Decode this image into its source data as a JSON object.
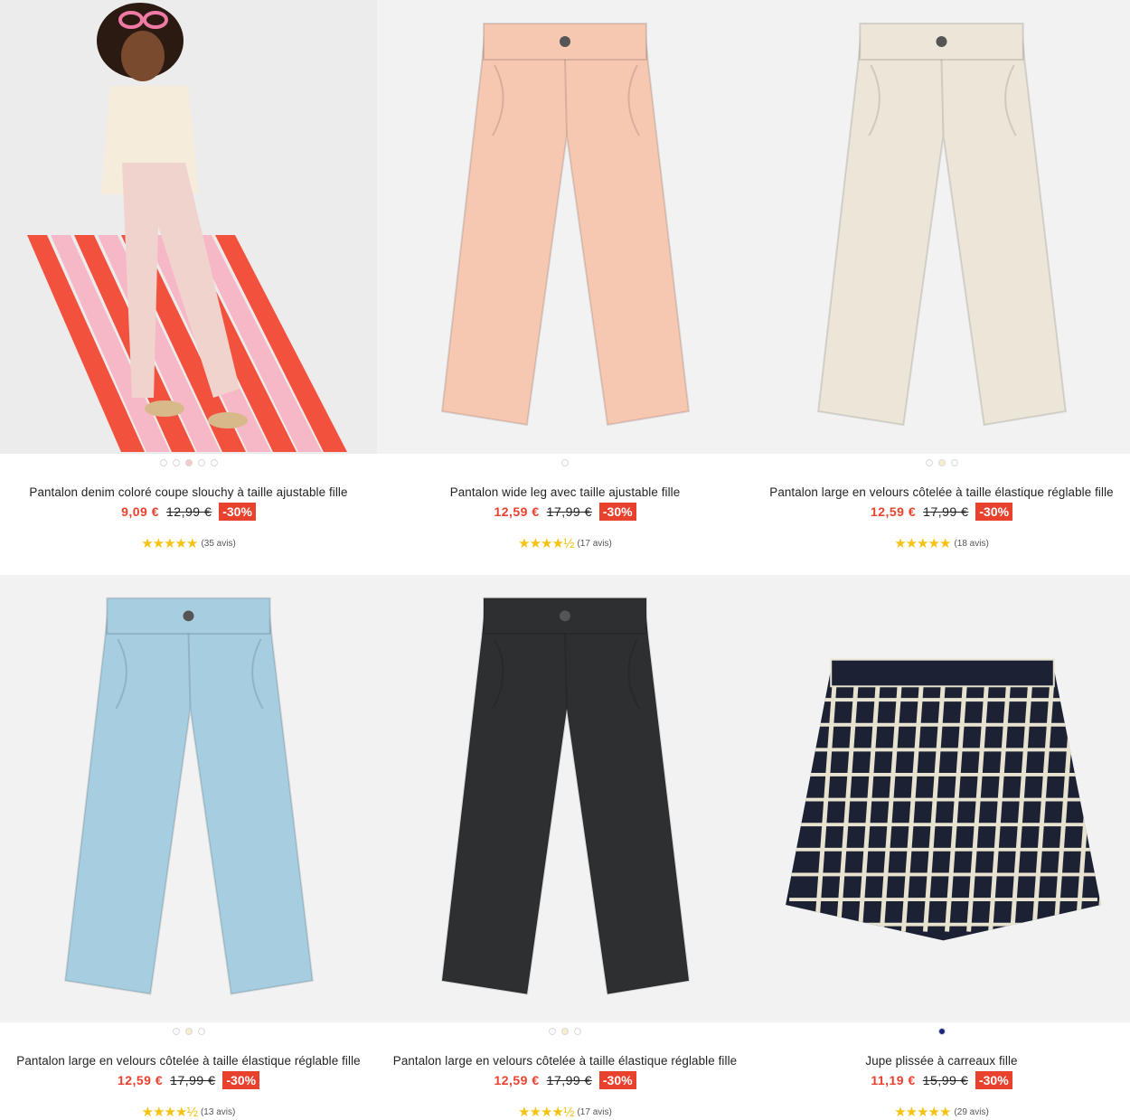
{
  "products": [
    {
      "title": "Pantalon denim coloré coupe slouchy à taille ajustable fille",
      "price": "9,09 €",
      "old_price": "12,99 €",
      "discount": "-30%",
      "stars": "★★★★★",
      "reviews": "(35 avis)",
      "dots": [
        "#ffffff",
        "#ffffff",
        "#f3c9cf",
        "#ffffff",
        "#ffffff"
      ],
      "image": "kid-model",
      "color": "#f2d6d0"
    },
    {
      "title": "Pantalon wide leg avec taille ajustable fille",
      "price": "12,59 €",
      "old_price": "17,99 €",
      "discount": "-30%",
      "stars": "★★★★½",
      "reviews": "(17 avis)",
      "dots": [
        "#ffffff"
      ],
      "image": "pants",
      "color": "#f6c8b2"
    },
    {
      "title": "Pantalon large en velours côtelée à taille élastique réglable fille",
      "price": "12,59 €",
      "old_price": "17,99 €",
      "discount": "-30%",
      "stars": "★★★★★",
      "reviews": "(18 avis)",
      "dots": [
        "#ffffff",
        "#f6efc9",
        "#ffffff"
      ],
      "image": "pants",
      "color": "#ece6d8"
    },
    {
      "title": "Pantalon large en velours côtelée à taille élastique réglable fille",
      "price": "12,59 €",
      "old_price": "17,99 €",
      "discount": "-30%",
      "stars": "★★★★½",
      "reviews": "(13 avis)",
      "dots": [
        "#ffffff",
        "#f6efc9",
        "#ffffff"
      ],
      "image": "pants",
      "color": "#a6cde0"
    },
    {
      "title": "Pantalon large en velours côtelée à taille élastique réglable fille",
      "price": "12,59 €",
      "old_price": "17,99 €",
      "discount": "-30%",
      "stars": "★★★★½",
      "reviews": "(17 avis)",
      "dots": [
        "#ffffff",
        "#f6efc9",
        "#ffffff"
      ],
      "image": "pants",
      "color": "#2e2f30"
    },
    {
      "title": "Jupe plissée à carreaux fille",
      "price": "11,19 €",
      "old_price": "15,99 €",
      "discount": "-30%",
      "stars": "★★★★★",
      "reviews": "(29 avis)",
      "dots": [
        "#1a2580"
      ],
      "image": "skirt",
      "color": "#1c2233"
    }
  ]
}
